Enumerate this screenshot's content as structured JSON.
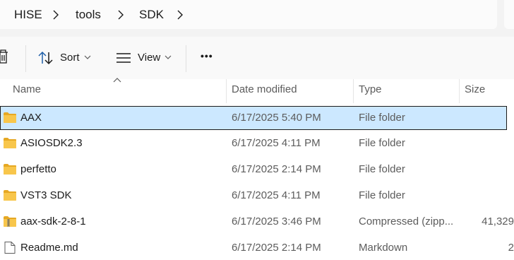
{
  "address": {
    "crumbs": [
      "HISE",
      "tools",
      "SDK"
    ]
  },
  "toolbar": {
    "sort_label": "Sort",
    "view_label": "View",
    "more_label": "•••"
  },
  "columns": {
    "name": "Name",
    "date": "Date modified",
    "type": "Type",
    "size": "Size"
  },
  "rows": [
    {
      "name": "AAX",
      "date": "6/17/2025 5:40 PM",
      "type": "File folder",
      "size": "",
      "icon": "folder-icon",
      "selected": true
    },
    {
      "name": "ASIOSDK2.3",
      "date": "6/17/2025 4:11 PM",
      "type": "File folder",
      "size": "",
      "icon": "folder-icon"
    },
    {
      "name": "perfetto",
      "date": "6/17/2025 2:14 PM",
      "type": "File folder",
      "size": "",
      "icon": "folder-icon"
    },
    {
      "name": "VST3 SDK",
      "date": "6/17/2025 4:11 PM",
      "type": "File folder",
      "size": "",
      "icon": "folder-icon"
    },
    {
      "name": "aax-sdk-2-8-1",
      "date": "6/17/2025 3:46 PM",
      "type": "Compressed (zipp...",
      "size": "41,329",
      "icon": "zip-folder-icon"
    },
    {
      "name": "Readme.md",
      "date": "6/17/2025 2:14 PM",
      "type": "Markdown",
      "size": "2",
      "icon": "file-icon"
    }
  ],
  "colors": {
    "selection_bg": "#cce8ff",
    "folder_yellow": "#f8c64b",
    "folder_yellow_dark": "#e6a823"
  }
}
